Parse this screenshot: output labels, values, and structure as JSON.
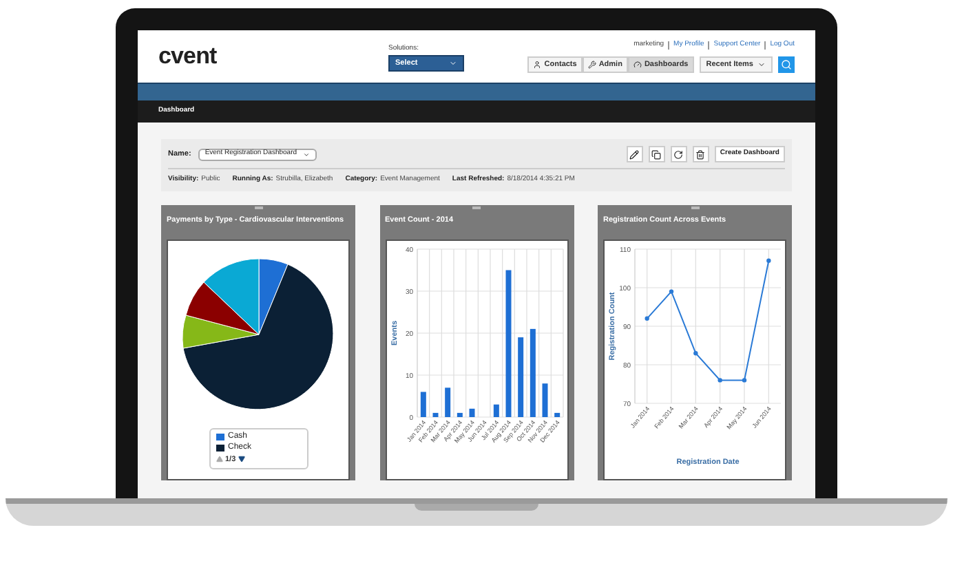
{
  "header": {
    "logo": "cvent",
    "solutions_label": "Solutions:",
    "solutions_select": "Select",
    "links": [
      "marketing",
      "My Profile",
      "Support Center",
      "Log Out"
    ],
    "nav_buttons": [
      {
        "label": "Contacts",
        "selected": false
      },
      {
        "label": "Admin",
        "selected": false
      },
      {
        "label": "Dashboards",
        "selected": true
      }
    ],
    "recent_items": "Recent Items"
  },
  "breadcrumb": "Dashboard",
  "dashboard": {
    "name_label": "Name:",
    "name_select": "Event Registration Dashboard",
    "create_button": "Create Dashboard",
    "meta": [
      {
        "label": "Visibility:",
        "value": "Public"
      },
      {
        "label": "Running As:",
        "value": "Strubilla, Elizabeth"
      },
      {
        "label": "Category:",
        "value": "Event Management"
      },
      {
        "label": "Last Refreshed:",
        "value": "8/18/2014 4:35:21 PM"
      }
    ]
  },
  "widgets": [
    {
      "title": "Payments by Type - Cardiovascular Interventions",
      "kind": "pie",
      "legend": [
        {
          "label": "Cash",
          "color": "#1e6fd4"
        },
        {
          "label": "Check",
          "color": "#0b2035"
        }
      ],
      "legend_page": "1/3"
    },
    {
      "title": "Event Count - 2014",
      "kind": "chart",
      "chart_data": {
        "type": "bar",
        "ylabel": "Events",
        "categories": [
          "Jan 2014",
          "Feb 2014",
          "Mar 2014",
          "Apr 2014",
          "May 2014",
          "Jun 2014",
          "Jul 2014",
          "Aug 2014",
          "Sep 2014",
          "Oct 2014",
          "Nov 2014",
          "Dec 2014"
        ],
        "series": [
          {
            "color": "#1e6fd4",
            "values": [
              6,
              1,
              7,
              1,
              2,
              0,
              3,
              35,
              19,
              21,
              8,
              1
            ]
          }
        ],
        "ylim": [
          0,
          40
        ],
        "yticks": [
          0,
          10,
          20,
          30,
          40
        ],
        "grid": true
      }
    },
    {
      "title": "Registration Count Across Events",
      "kind": "chart",
      "chart_data": {
        "type": "line",
        "xlabel": "Registration Date",
        "ylabel": "Registration Count",
        "categories": [
          "Jan 2014",
          "Feb 2014",
          "Mar 2014",
          "Apr 2014",
          "May 2014",
          "Jun 2014"
        ],
        "series": [
          {
            "color": "#2a7ad6",
            "marker": "circle",
            "values": [
              92,
              99,
              83,
              76,
              76,
              107
            ]
          }
        ],
        "ylim": [
          70,
          110
        ],
        "yticks": [
          70,
          80,
          90,
          100,
          110
        ],
        "grid": true
      }
    }
  ]
}
